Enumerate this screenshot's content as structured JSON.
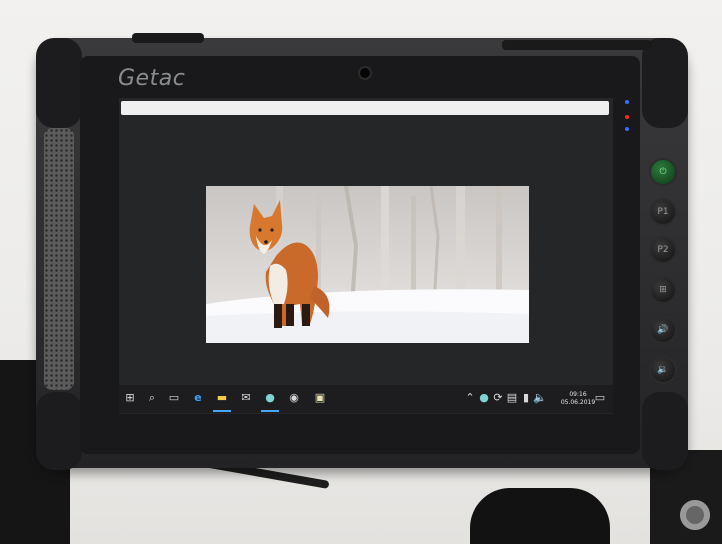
{
  "device": {
    "brand": "Getac"
  },
  "screen": {
    "photo_subject": "red fox standing in snow"
  },
  "taskbar": {
    "clock_time": "09:16",
    "clock_date": "05.06.2019",
    "icons": [
      "windows-start-icon",
      "search-icon",
      "task-view-icon",
      "edge-icon",
      "file-explorer-icon",
      "mail-icon",
      "browser-icon",
      "app-icon",
      "store-icon"
    ]
  },
  "side_buttons": {
    "p1": "P1",
    "p2": "P2"
  },
  "colors": {
    "accent": "#4aa3ff",
    "power": "#2c7a3c"
  }
}
